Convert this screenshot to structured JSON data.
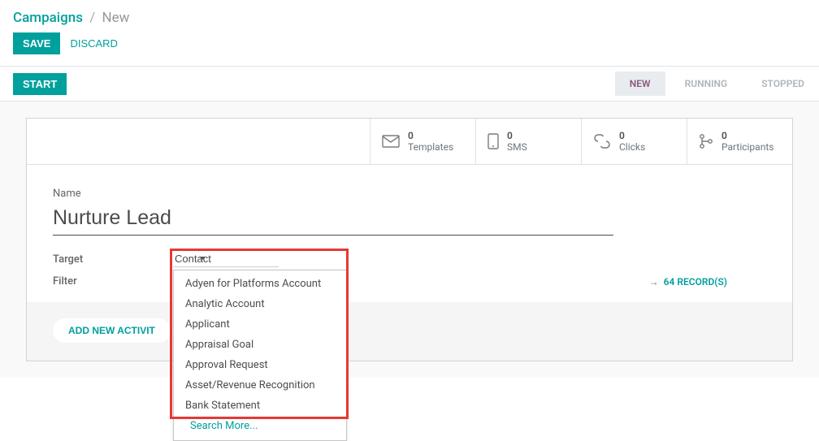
{
  "breadcrumb": {
    "main": "Campaigns",
    "sep": "/",
    "current": "New"
  },
  "toolbar": {
    "save": "SAVE",
    "discard": "DISCARD",
    "start": "START"
  },
  "status": {
    "new": "NEW",
    "running": "RUNNING",
    "stopped": "STOPPED"
  },
  "stats": {
    "templates": {
      "count": "0",
      "label": "Templates"
    },
    "sms": {
      "count": "0",
      "label": "SMS"
    },
    "clicks": {
      "count": "0",
      "label": "Clicks"
    },
    "participants": {
      "count": "0",
      "label": "Participants"
    }
  },
  "form": {
    "name_label": "Name",
    "name_value": "Nurture Lead",
    "target_label": "Target",
    "target_value": "Contact",
    "filter_label": "Filter",
    "records_link": "64 RECORD(S)",
    "arrow": "→"
  },
  "dropdown": {
    "items": [
      "Adyen for Platforms Account",
      "Analytic Account",
      "Applicant",
      "Appraisal Goal",
      "Approval Request",
      "Asset/Revenue Recognition",
      "Bank Statement"
    ],
    "search_more": "Search More..."
  },
  "activity": {
    "add": "ADD NEW ACTIVIT"
  }
}
